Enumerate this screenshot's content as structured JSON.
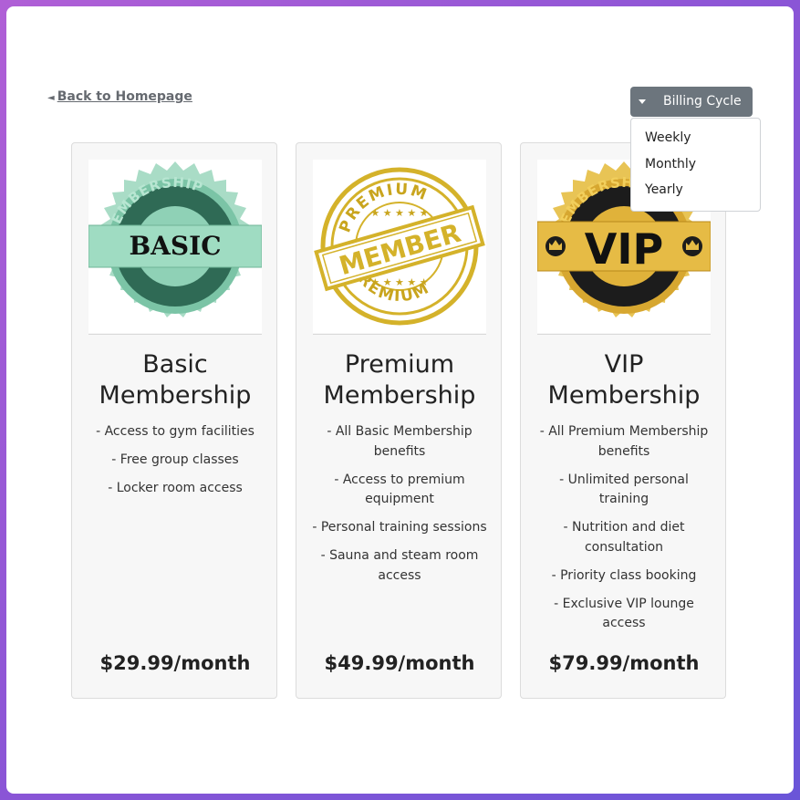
{
  "nav": {
    "back_label": "Back to Homepage",
    "back_arrow": "◄"
  },
  "billing": {
    "button_label": "Billing Cycle",
    "options": [
      "Weekly",
      "Monthly",
      "Yearly"
    ]
  },
  "plans": [
    {
      "badge_text": "BASIC",
      "badge_ring_text": "MEMBERSHIP",
      "title_line1": "Basic",
      "title_line2": "Membership",
      "features": [
        "- Access to gym facilities",
        "- Free group classes",
        "- Locker room access"
      ],
      "price": "$29.99/month",
      "badge_colors": {
        "main": "#8fd1b6",
        "dark": "#2f6a55",
        "light": "#c8eadc"
      }
    },
    {
      "badge_text": "MEMBER",
      "badge_ring_top": "PREMIUM",
      "badge_ring_bottom": "PREMIUM",
      "title_line1": "Premium",
      "title_line2": "Membership",
      "features": [
        "- All Basic Membership benefits",
        "- Access to premium equipment",
        "- Personal training sessions",
        "- Sauna and steam room access"
      ],
      "price": "$49.99/month",
      "badge_colors": {
        "main": "#d4b22a",
        "dark": "#a88414"
      }
    },
    {
      "badge_text": "VIP",
      "badge_ring_text": "MEMBERSHIP",
      "title_line1": "VIP",
      "title_line2": "Membership",
      "features": [
        "- All Premium Membership benefits",
        "- Unlimited personal training",
        "- Nutrition and diet consultation",
        "- Priority class booking",
        "- Exclusive VIP lounge access"
      ],
      "price": "$79.99/month",
      "badge_colors": {
        "main": "#e0b23a",
        "dark": "#1c1c1c",
        "light": "#f5d870"
      }
    }
  ]
}
